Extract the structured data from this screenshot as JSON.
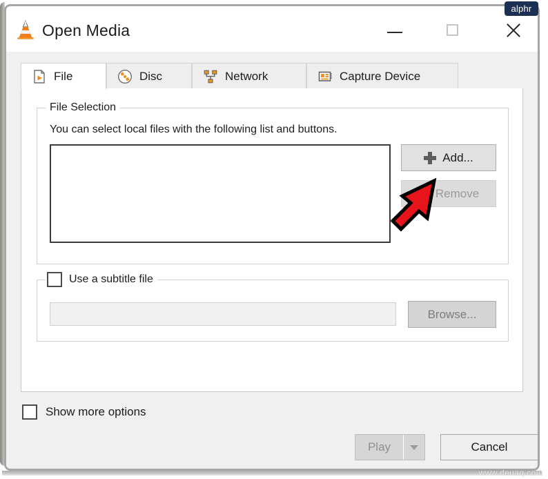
{
  "window": {
    "title": "Open Media",
    "app_icon": "vlc-cone-icon",
    "controls": {
      "minimize": "minimize-icon",
      "maximize": "maximize-icon",
      "close": "close-icon"
    }
  },
  "badge": {
    "text": "alphr"
  },
  "tabs": [
    {
      "label": "File",
      "icon": "file-play-icon",
      "active": true
    },
    {
      "label": "Disc",
      "icon": "disc-icon",
      "active": false
    },
    {
      "label": "Network",
      "icon": "network-icon",
      "active": false
    },
    {
      "label": "Capture Device",
      "icon": "capture-device-icon",
      "active": false
    }
  ],
  "file_selection": {
    "group_title": "File Selection",
    "helper_text": "You can select local files with the following list and buttons.",
    "list_items": [],
    "add_button": {
      "label": "Add...",
      "icon": "plus-icon",
      "enabled": true
    },
    "remove_button": {
      "label": "Remove",
      "icon": "minus-icon",
      "enabled": false
    }
  },
  "subtitle": {
    "checkbox_label": "Use a subtitle file",
    "checked": false,
    "path_value": "",
    "browse_button": {
      "label": "Browse...",
      "enabled": false
    }
  },
  "footer": {
    "show_more_label": "Show more options",
    "show_more_checked": false,
    "play_button": {
      "label": "Play",
      "enabled": false,
      "dropdown_icon": "chevron-down-icon"
    },
    "cancel_button": {
      "label": "Cancel",
      "enabled": true
    }
  },
  "annotation": {
    "arrow": "red-arrow-pointing-to-add-button",
    "color": "#e8141b"
  },
  "watermark": {
    "text": "www.deuaq.com"
  }
}
